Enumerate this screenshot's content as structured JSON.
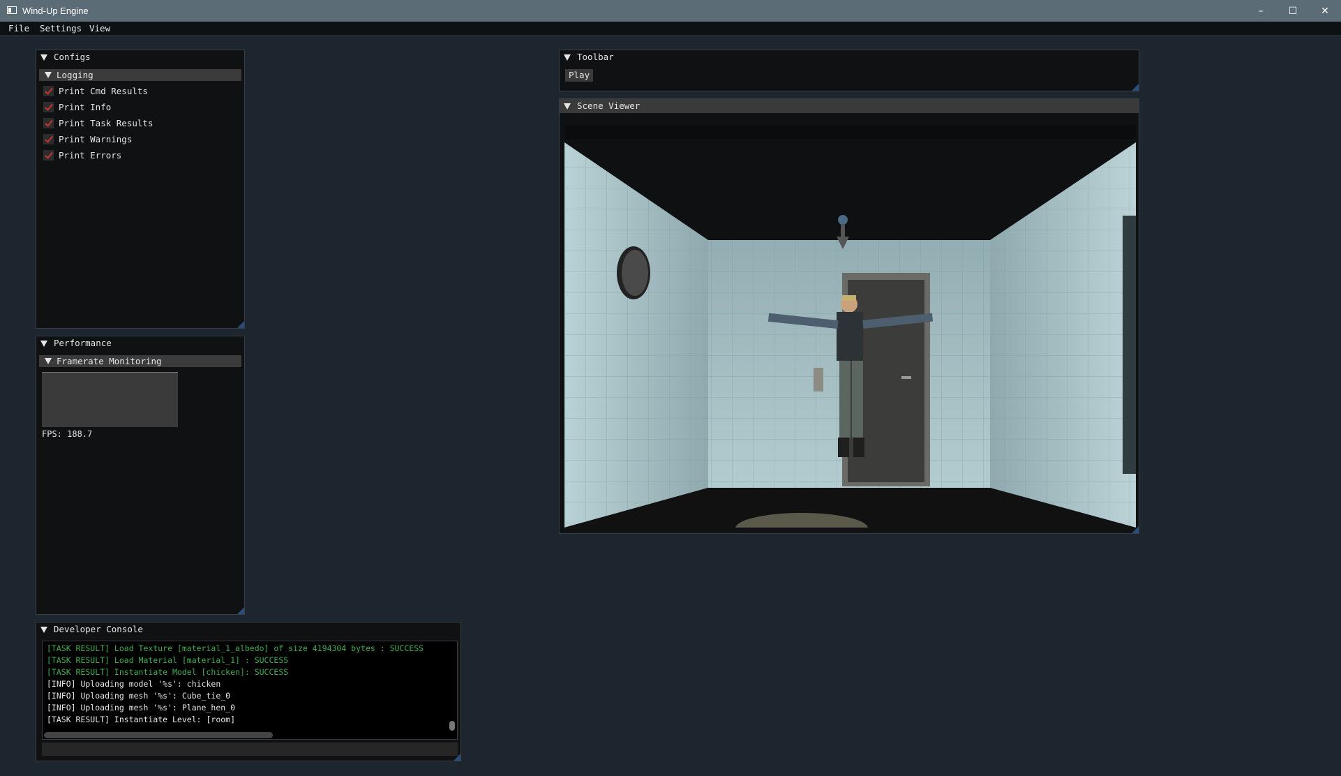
{
  "window": {
    "title": "Wind-Up Engine",
    "controls": {
      "minimize": "–",
      "maximize": "☐",
      "close": "✕"
    }
  },
  "menu": {
    "items": [
      "File",
      "Settings",
      "View"
    ]
  },
  "configs": {
    "title": "Configs",
    "section": "Logging",
    "options": [
      {
        "label": "Print Cmd Results",
        "checked": true
      },
      {
        "label": "Print Info",
        "checked": true
      },
      {
        "label": "Print Task Results",
        "checked": true
      },
      {
        "label": "Print Warnings",
        "checked": true
      },
      {
        "label": "Print Errors",
        "checked": true
      }
    ]
  },
  "performance": {
    "title": "Performance",
    "section": "Framerate Monitoring",
    "fps_text": "FPS: 188.7"
  },
  "console": {
    "title": "Developer Console",
    "lines": [
      {
        "text": "[TASK RESULT] Load Texture [material_1_albedo] of size 4194304 bytes : SUCCESS",
        "color": "#3fae4f"
      },
      {
        "text": "[TASK RESULT] Load Material [material_1] : SUCCESS",
        "color": "#3fae4f"
      },
      {
        "text": "[TASK RESULT] Instantiate Model [chicken]: SUCCESS",
        "color": "#3fae4f"
      },
      {
        "text": "[INFO] Uploading model '%s': chicken",
        "color": "#e6e6e6"
      },
      {
        "text": "[INFO] Uploading mesh '%s': Cube_tie_0",
        "color": "#e6e6e6"
      },
      {
        "text": "[INFO] Uploading mesh '%s': Plane_hen_0",
        "color": "#e6e6e6"
      },
      {
        "text": "[TASK RESULT] Instantiate Level: [room]",
        "color": "#e6e6e6"
      }
    ]
  },
  "toolbar": {
    "title": "Toolbar",
    "play_label": "Play"
  },
  "scene_viewer": {
    "title": "Scene Viewer"
  },
  "colors": {
    "background": "#1d262f",
    "titlebar": "#5c6c77",
    "panel": "#0f1113",
    "check_mark": "#cc3333",
    "success_text": "#3fae4f"
  }
}
